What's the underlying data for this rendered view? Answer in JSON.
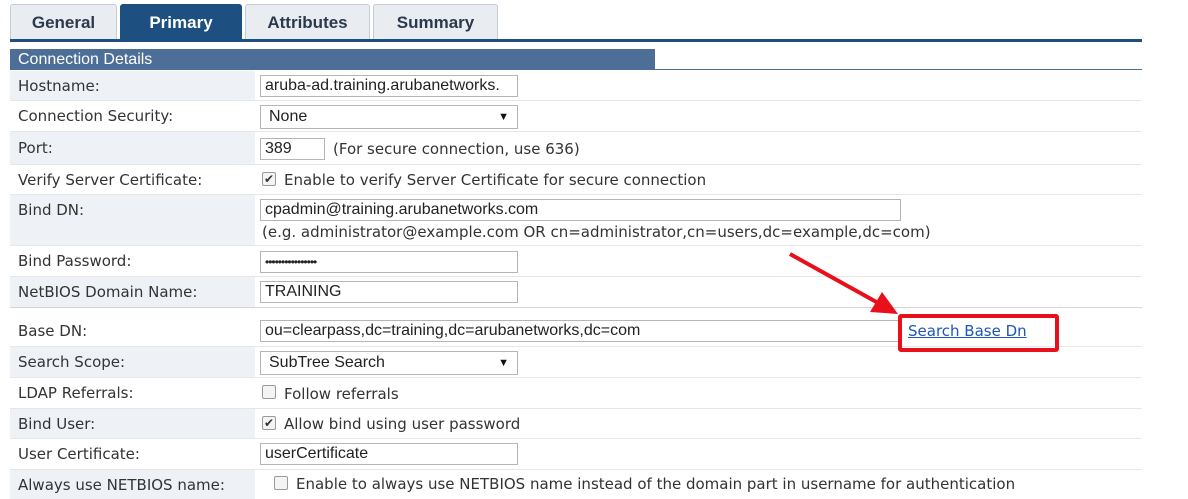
{
  "tabs": [
    {
      "label": "General",
      "active": false
    },
    {
      "label": "Primary",
      "active": true
    },
    {
      "label": "Attributes",
      "active": false
    },
    {
      "label": "Summary",
      "active": false
    }
  ],
  "section": {
    "title": "Connection Details"
  },
  "fields": {
    "hostname": {
      "label": "Hostname:",
      "value": "aruba-ad.training.arubanetworks."
    },
    "connection_security": {
      "label": "Connection Security:",
      "value": "None"
    },
    "port": {
      "label": "Port:",
      "value": "389",
      "hint": "(For secure connection, use 636)"
    },
    "verify_cert": {
      "label": "Verify Server Certificate:",
      "checked": true,
      "text": "Enable to verify Server Certificate for secure connection"
    },
    "bind_dn": {
      "label": "Bind DN:",
      "value": "cpadmin@training.arubanetworks.com",
      "hint": "(e.g. administrator@example.com OR cn=administrator,cn=users,dc=example,dc=com)"
    },
    "bind_password": {
      "label": "Bind Password:",
      "value": "••••••••••••••••"
    },
    "netbios_domain": {
      "label": "NetBIOS Domain Name:",
      "value": "TRAINING"
    },
    "base_dn": {
      "label": "Base DN:",
      "value": "ou=clearpass,dc=training,dc=arubanetworks,dc=com",
      "link": "Search Base Dn"
    },
    "search_scope": {
      "label": "Search Scope:",
      "value": "SubTree Search"
    },
    "ldap_referrals": {
      "label": "LDAP Referrals:",
      "checked": false,
      "text": "Follow referrals"
    },
    "bind_user": {
      "label": "Bind User:",
      "checked": true,
      "text": "Allow bind using user password"
    },
    "user_certificate": {
      "label": "User Certificate:",
      "value": "userCertificate"
    },
    "always_netbios": {
      "label": "Always use NETBIOS name:",
      "checked": false,
      "text": "Enable to always use NETBIOS name instead of the domain part in username for authentication"
    }
  },
  "icons": {
    "checkmark": "✔",
    "dropdown": "▼"
  },
  "colors": {
    "tab_active": "#1d4f80",
    "section_header": "#4d6f97",
    "highlight": "#e8101a",
    "link": "#1c56b8"
  }
}
